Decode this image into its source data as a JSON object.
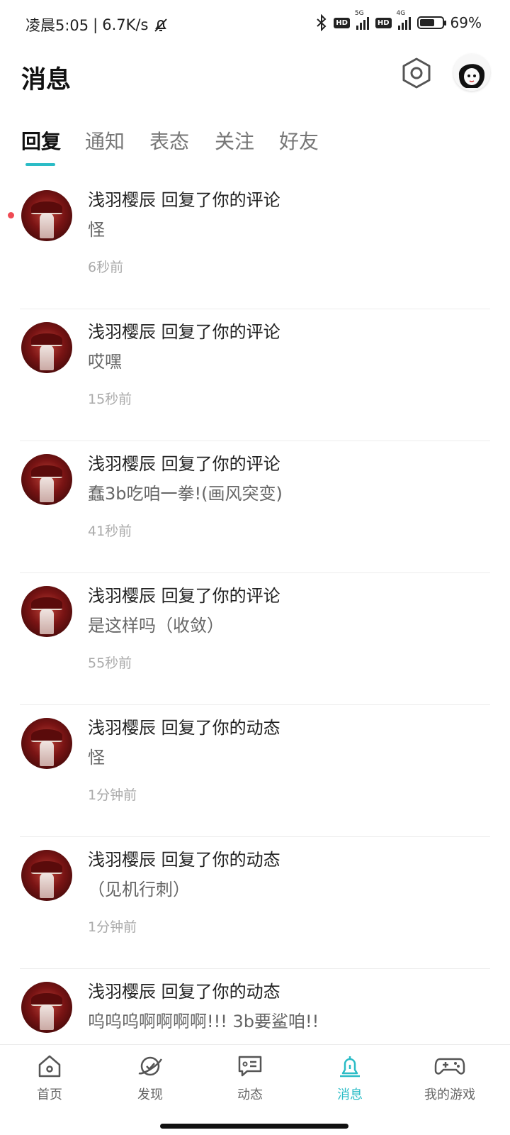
{
  "status_bar": {
    "time": "凌晨5:05",
    "separator": "|",
    "net_speed": "6.7K/s",
    "hd1": "HD",
    "signal1_type": "5G",
    "hd2": "HD",
    "signal2_type": "4G",
    "battery_percent": "69%",
    "battery_level": 0.69
  },
  "header": {
    "title": "消息"
  },
  "tabs": [
    {
      "label": "回复",
      "active": true
    },
    {
      "label": "通知",
      "active": false
    },
    {
      "label": "表态",
      "active": false
    },
    {
      "label": "关注",
      "active": false
    },
    {
      "label": "好友",
      "active": false
    }
  ],
  "messages": [
    {
      "title": "浅羽樱辰 回复了你的评论",
      "content": "怪",
      "time": "6秒前",
      "unread": true
    },
    {
      "title": "浅羽樱辰 回复了你的评论",
      "content": "哎嘿",
      "time": "15秒前",
      "unread": false
    },
    {
      "title": "浅羽樱辰 回复了你的评论",
      "content": "蠢3b吃咱一拳!(画风突变)",
      "time": "41秒前",
      "unread": false
    },
    {
      "title": "浅羽樱辰 回复了你的评论",
      "content": "是这样吗（收敛）",
      "time": "55秒前",
      "unread": false
    },
    {
      "title": "浅羽樱辰 回复了你的动态",
      "content": "怪",
      "time": "1分钟前",
      "unread": false
    },
    {
      "title": "浅羽樱辰 回复了你的动态",
      "content": "（见机行刺）",
      "time": "1分钟前",
      "unread": false
    },
    {
      "title": "浅羽樱辰 回复了你的动态",
      "content": "呜呜呜啊啊啊啊!!! 3b要鲨咱!!",
      "time": "",
      "unread": false
    }
  ],
  "bottom_nav": [
    {
      "label": "首页",
      "icon": "home-icon",
      "active": false
    },
    {
      "label": "发现",
      "icon": "planet-icon",
      "active": false
    },
    {
      "label": "动态",
      "icon": "chat-icon",
      "active": false
    },
    {
      "label": "消息",
      "icon": "bell-icon",
      "active": true
    },
    {
      "label": "我的游戏",
      "icon": "gamepad-icon",
      "active": false
    }
  ],
  "colors": {
    "accent": "#2bbcc6",
    "unread_dot": "#ef4b54"
  }
}
